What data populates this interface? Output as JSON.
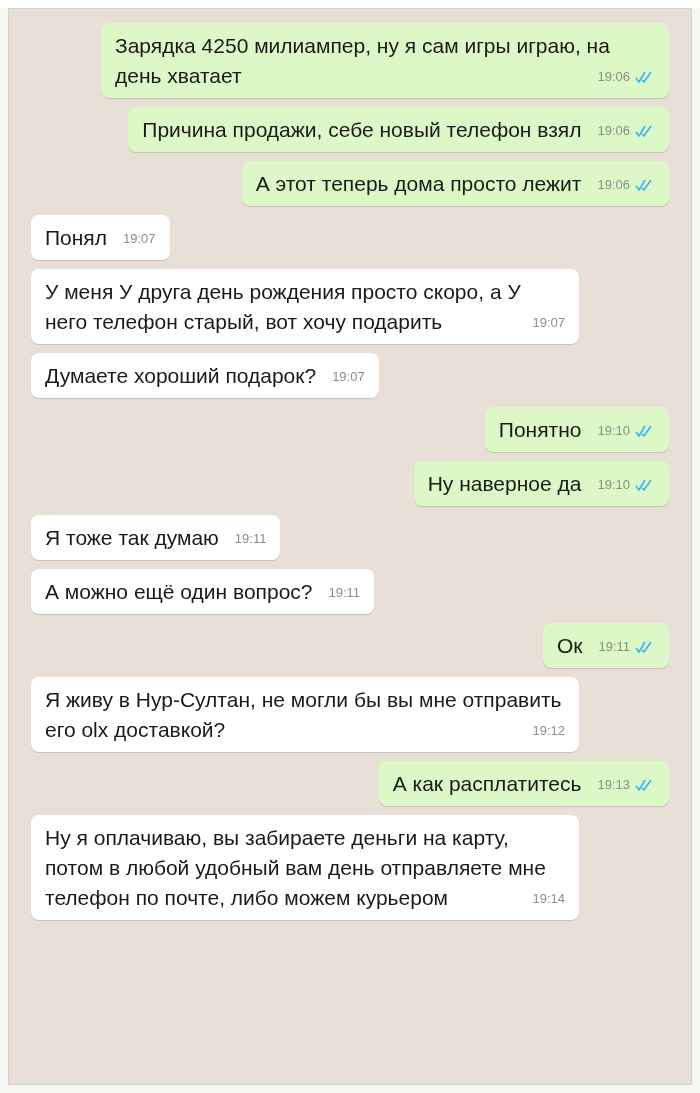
{
  "messages": [
    {
      "kind": "outgoing",
      "text": "Зарядка 4250 милиампер, ну я сам игры играю, на день хватает",
      "time": "19:06",
      "read": true
    },
    {
      "kind": "outgoing",
      "text": "Причина продажи,  себе новый телефон взял",
      "time": "19:06",
      "read": true
    },
    {
      "kind": "outgoing",
      "text": "А этот теперь дома просто лежит",
      "time": "19:06",
      "read": true
    },
    {
      "kind": "incoming",
      "text": "Понял",
      "time": "19:07"
    },
    {
      "kind": "incoming",
      "text": "У меня У друга день рождения просто скоро, а У него телефон старый, вот хочу подарить",
      "time": "19:07"
    },
    {
      "kind": "incoming",
      "text": "Думаете хороший подарок?",
      "time": "19:07"
    },
    {
      "kind": "outgoing",
      "text": "Понятно",
      "time": "19:10",
      "read": true
    },
    {
      "kind": "outgoing",
      "text": "Ну наверное да",
      "time": "19:10",
      "read": true
    },
    {
      "kind": "incoming",
      "text": "Я тоже так думаю",
      "time": "19:11"
    },
    {
      "kind": "incoming",
      "text": "А можно ещё один вопрос?",
      "time": "19:11"
    },
    {
      "kind": "outgoing",
      "text": "Ок",
      "time": "19:11",
      "read": true
    },
    {
      "kind": "incoming",
      "text": "Я живу в Нур-Султан, не могли бы вы мне отправить его olx доставкой?",
      "time": "19:12"
    },
    {
      "kind": "outgoing",
      "text": "А как расплатитесь",
      "time": "19:13",
      "read": true
    },
    {
      "kind": "incoming",
      "text": "Ну я оплачиваю, вы забираете деньги на карту, потом в любой удобный вам день отправляете мне телефон по почте, либо можем курьером",
      "time": "19:14"
    }
  ]
}
